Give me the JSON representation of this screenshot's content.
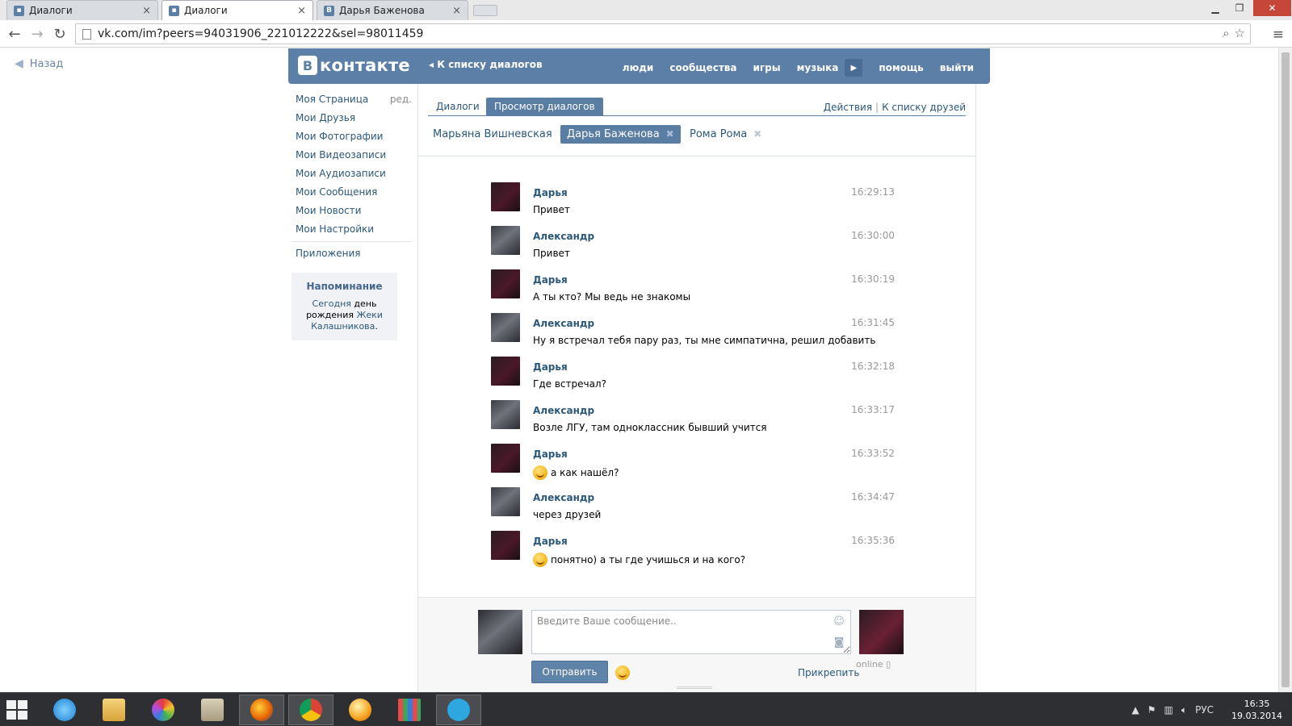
{
  "browser": {
    "tabs": [
      {
        "title": "Диалоги",
        "favicon": "vk-message-icon"
      },
      {
        "title": "Диалоги",
        "favicon": "vk-message-icon"
      },
      {
        "title": "Дарья Баженова",
        "favicon": "vk-logo-icon"
      }
    ],
    "url": "vk.com/im?peers=94031906_221012222&sel=98011459",
    "back_label": "Назад"
  },
  "header": {
    "logo_text": "контакте",
    "logo_letter": "В",
    "back_to_list": "К списку диалогов",
    "nav": [
      "люди",
      "сообщества",
      "игры",
      "музыка",
      "помощь",
      "выйти"
    ]
  },
  "leftmenu": {
    "items": [
      "Моя Страница",
      "Мои Друзья",
      "Мои Фотографии",
      "Мои Видеозаписи",
      "Мои Аудиозаписи",
      "Мои Сообщения",
      "Мои Новости",
      "Мои Настройки"
    ],
    "edit_label": "ред.",
    "apps_label": "Приложения",
    "reminder": {
      "title": "Напоминание",
      "part1": "Сегодня",
      "part2": " день рождения ",
      "part3": "Жеки Калашникова",
      "part4": "."
    }
  },
  "content": {
    "tabs": [
      "Диалоги",
      "Просмотр диалогов"
    ],
    "actions": "Действия",
    "friends_list": "К списку друзей",
    "peers": [
      "Марьяна Вишневская",
      "Дарья Баженова",
      "Рома Рома"
    ]
  },
  "messages": [
    {
      "author": "Дарья",
      "time": "16:29:13",
      "text": "Привет",
      "emoji": false
    },
    {
      "author": "Александр",
      "time": "16:30:00",
      "text": "Привет",
      "emoji": false
    },
    {
      "author": "Дарья",
      "time": "16:30:19",
      "text": "А ты кто? Мы ведь не знакомы",
      "emoji": false
    },
    {
      "author": "Александр",
      "time": "16:31:45",
      "text": "Ну я встречал тебя пару раз, ты мне симпатична, решил добавить",
      "emoji": false
    },
    {
      "author": "Дарья",
      "time": "16:32:18",
      "text": "Где встречал?",
      "emoji": false
    },
    {
      "author": "Александр",
      "time": "16:33:17",
      "text": "Возле ЛГУ, там одноклассник бывший учится",
      "emoji": false
    },
    {
      "author": "Дарья",
      "time": "16:33:52",
      "text": "а как нашёл?",
      "emoji": true
    },
    {
      "author": "Александр",
      "time": "16:34:47",
      "text": "через друзей",
      "emoji": false
    },
    {
      "author": "Дарья",
      "time": "16:35:36",
      "text": "понятно) а ты где учишься и на кого?",
      "emoji": true
    }
  ],
  "composer": {
    "placeholder": "Введите Ваше сообщение..",
    "send": "Отправить",
    "attach": "Прикрепить",
    "online": "online"
  },
  "taskbar": {
    "lang": "РУС",
    "time": "16:35",
    "date": "19.03.2014"
  }
}
